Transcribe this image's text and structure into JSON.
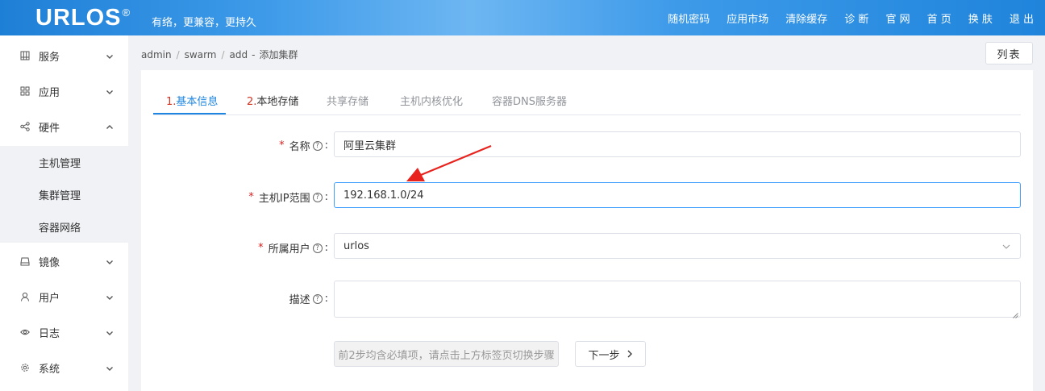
{
  "header": {
    "logo": "URLOS",
    "logo_mark": "®",
    "slogan": "有络，更兼容，更持久",
    "nav": [
      "随机密码",
      "应用市场",
      "清除缓存",
      "诊 断",
      "官 网",
      "首 页",
      "换 肤",
      "退 出"
    ]
  },
  "sidebar": {
    "items": [
      {
        "label": "服务",
        "icon": "grid-icon"
      },
      {
        "label": "应用",
        "icon": "apps-icon"
      },
      {
        "label": "硬件",
        "icon": "share-nodes-icon"
      },
      {
        "label": "镜像",
        "icon": "disk-icon"
      },
      {
        "label": "用户",
        "icon": "user-icon"
      },
      {
        "label": "日志",
        "icon": "eye-icon"
      },
      {
        "label": "系统",
        "icon": "gear-icon"
      }
    ],
    "sub_items": [
      "主机管理",
      "集群管理",
      "容器网络"
    ]
  },
  "breadcrumb": {
    "parts": [
      "admin",
      "swarm",
      "add"
    ],
    "title": "添加集群"
  },
  "list_button": "列表",
  "tabs": [
    {
      "num": "1.",
      "label": "基本信息"
    },
    {
      "num": "2.",
      "label": "本地存储"
    },
    {
      "num": "",
      "label": "共享存储"
    },
    {
      "num": "",
      "label": "主机内核优化"
    },
    {
      "num": "",
      "label": "容器DNS服务器"
    }
  ],
  "form": {
    "name_label": "名称",
    "name_value": "阿里云集群",
    "ip_label": "主机IP范围",
    "ip_value": "192.168.1.0/24",
    "owner_label": "所属用户",
    "owner_value": "urlos",
    "desc_label": "描述",
    "desc_value": "",
    "required_mark": "*",
    "help_mark": "?",
    "colon": ":"
  },
  "buttons": {
    "hint": "前2步均含必填项，请点击上方标签页切换步骤",
    "next": "下一步"
  },
  "colors": {
    "primary": "#1e86e0",
    "required": "#e02020",
    "annotation_arrow": "#e8231e"
  }
}
